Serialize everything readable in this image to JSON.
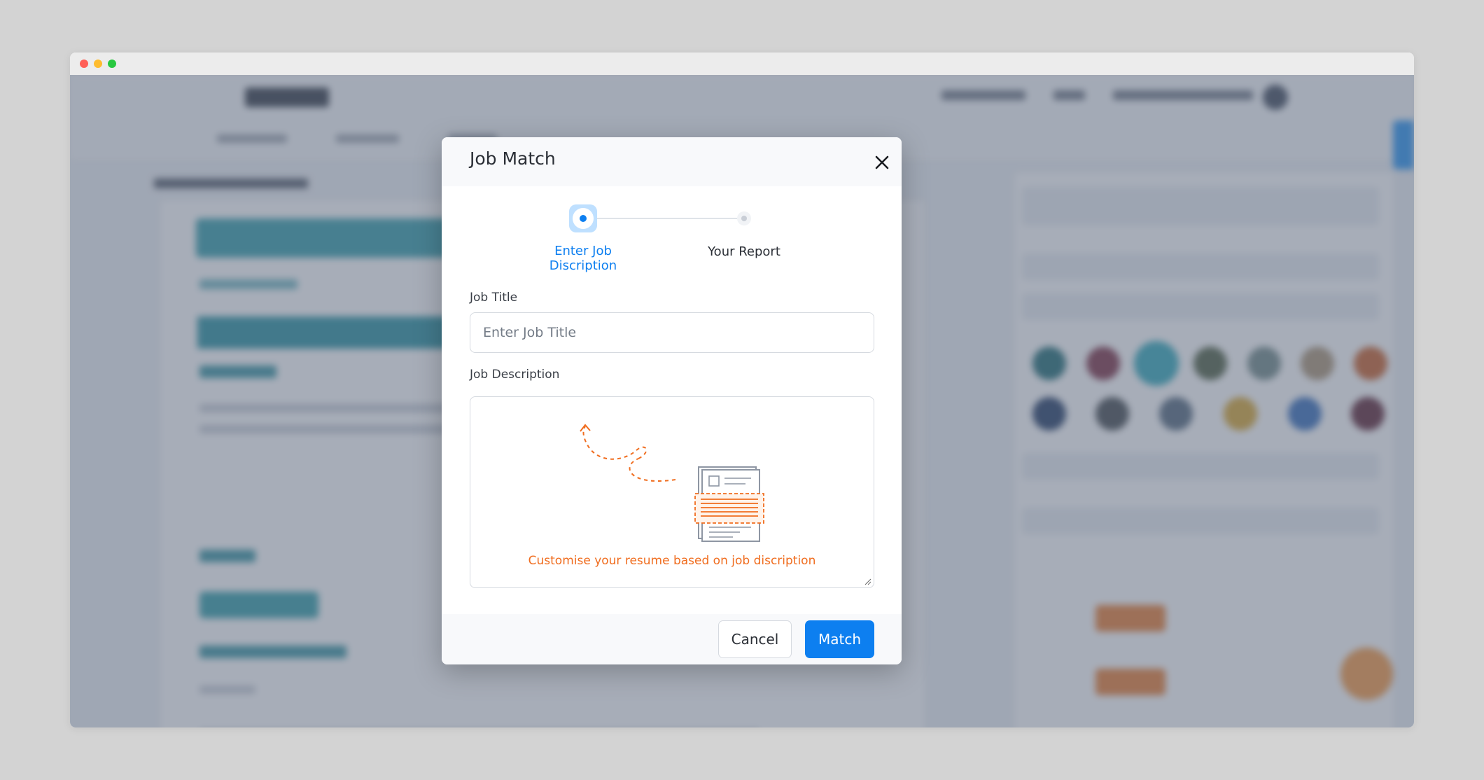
{
  "colors": {
    "primary": "#0d7ff0",
    "accent": "#f06d1f",
    "overlay": "rgba(95,105,125,0.55)"
  },
  "modal": {
    "title": "Job Match",
    "close_icon": "close-icon",
    "steps": [
      {
        "label": "Enter Job Discription",
        "state": "active"
      },
      {
        "label": "Your Report",
        "state": "inactive"
      }
    ],
    "job_title": {
      "label": "Job Title",
      "value": "",
      "placeholder": "Enter Job Title"
    },
    "job_description": {
      "label": "Job Description",
      "illustration": "resume-document-illustration",
      "hint": "Customise your resume based on job discription"
    },
    "buttons": {
      "cancel": "Cancel",
      "match": "Match"
    }
  }
}
